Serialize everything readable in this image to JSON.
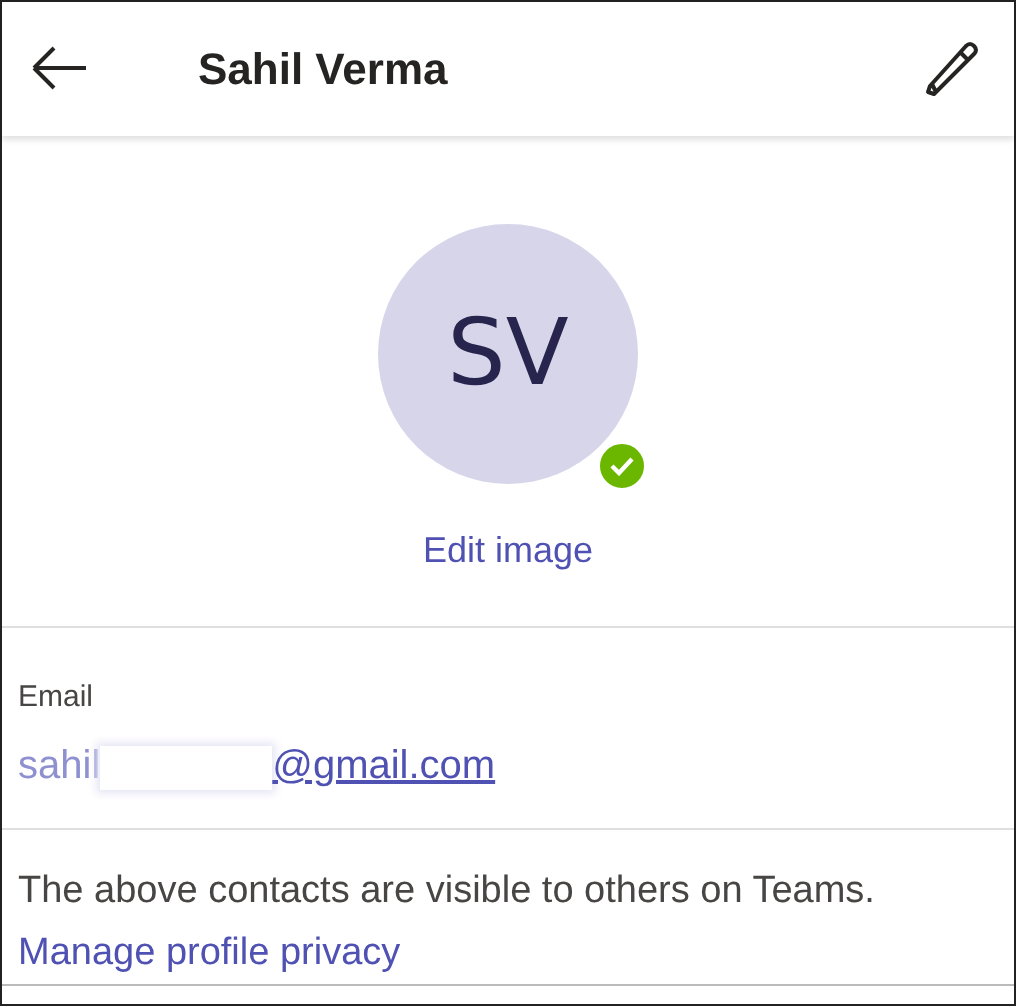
{
  "header": {
    "title": "Sahil Verma"
  },
  "profile": {
    "initials": "SV",
    "available": true,
    "edit_label": "Edit image"
  },
  "email": {
    "label": "Email",
    "visible_start": "sahil",
    "redacted": true,
    "domain": "@gmail.com"
  },
  "footer": {
    "text": "The above contacts are visible to others on Teams.",
    "link": "Manage profile privacy"
  }
}
